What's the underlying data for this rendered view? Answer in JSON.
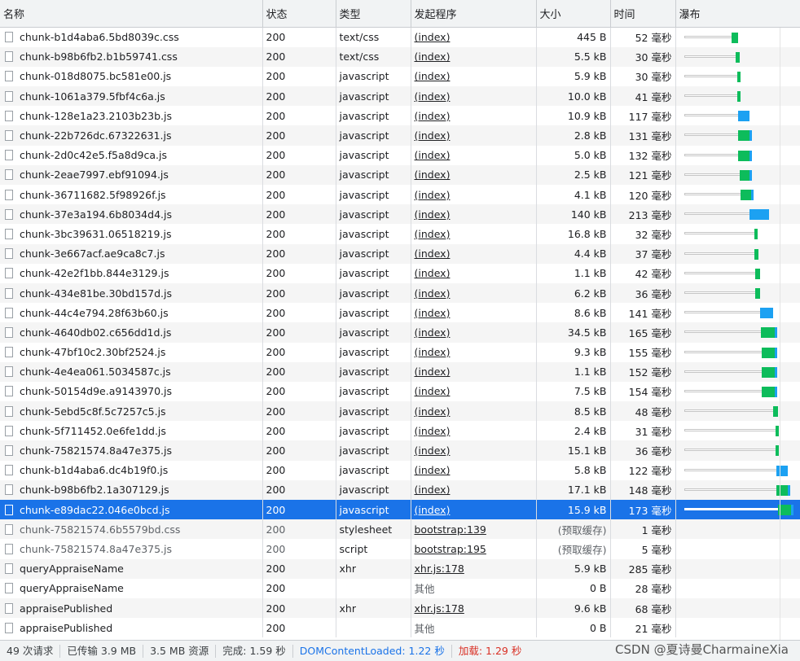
{
  "columns": [
    "名称",
    "状态",
    "类型",
    "发起程序",
    "大小",
    "时间",
    "瀑布"
  ],
  "rows": [
    {
      "name": "chunk-b1d4aba6.5bd8039c.css",
      "status": "200",
      "type": "text/css",
      "initiator": "(index)",
      "size": "445 B",
      "time": "52 毫秒"
    },
    {
      "name": "chunk-b98b6fb2.b1b59741.css",
      "status": "200",
      "type": "text/css",
      "initiator": "(index)",
      "size": "5.5 kB",
      "time": "30 毫秒"
    },
    {
      "name": "chunk-018d8075.bc581e00.js",
      "status": "200",
      "type": "javascript",
      "initiator": "(index)",
      "size": "5.9 kB",
      "time": "30 毫秒"
    },
    {
      "name": "chunk-1061a379.5fbf4c6a.js",
      "status": "200",
      "type": "javascript",
      "initiator": "(index)",
      "size": "10.0 kB",
      "time": "41 毫秒"
    },
    {
      "name": "chunk-128e1a23.2103b23b.js",
      "status": "200",
      "type": "javascript",
      "initiator": "(index)",
      "size": "10.9 kB",
      "time": "117 毫秒"
    },
    {
      "name": "chunk-22b726dc.67322631.js",
      "status": "200",
      "type": "javascript",
      "initiator": "(index)",
      "size": "2.8 kB",
      "time": "131 毫秒"
    },
    {
      "name": "chunk-2d0c42e5.f5a8d9ca.js",
      "status": "200",
      "type": "javascript",
      "initiator": "(index)",
      "size": "5.0 kB",
      "time": "132 毫秒"
    },
    {
      "name": "chunk-2eae7997.ebf91094.js",
      "status": "200",
      "type": "javascript",
      "initiator": "(index)",
      "size": "2.5 kB",
      "time": "121 毫秒"
    },
    {
      "name": "chunk-36711682.5f98926f.js",
      "status": "200",
      "type": "javascript",
      "initiator": "(index)",
      "size": "4.1 kB",
      "time": "120 毫秒"
    },
    {
      "name": "chunk-37e3a194.6b8034d4.js",
      "status": "200",
      "type": "javascript",
      "initiator": "(index)",
      "size": "140 kB",
      "time": "213 毫秒"
    },
    {
      "name": "chunk-3bc39631.06518219.js",
      "status": "200",
      "type": "javascript",
      "initiator": "(index)",
      "size": "16.8 kB",
      "time": "32 毫秒"
    },
    {
      "name": "chunk-3e667acf.ae9ca8c7.js",
      "status": "200",
      "type": "javascript",
      "initiator": "(index)",
      "size": "4.4 kB",
      "time": "37 毫秒"
    },
    {
      "name": "chunk-42e2f1bb.844e3129.js",
      "status": "200",
      "type": "javascript",
      "initiator": "(index)",
      "size": "1.1 kB",
      "time": "42 毫秒"
    },
    {
      "name": "chunk-434e81be.30bd157d.js",
      "status": "200",
      "type": "javascript",
      "initiator": "(index)",
      "size": "6.2 kB",
      "time": "36 毫秒"
    },
    {
      "name": "chunk-44c4e794.28f63b60.js",
      "status": "200",
      "type": "javascript",
      "initiator": "(index)",
      "size": "8.6 kB",
      "time": "141 毫秒"
    },
    {
      "name": "chunk-4640db02.c656dd1d.js",
      "status": "200",
      "type": "javascript",
      "initiator": "(index)",
      "size": "34.5 kB",
      "time": "165 毫秒"
    },
    {
      "name": "chunk-47bf10c2.30bf2524.js",
      "status": "200",
      "type": "javascript",
      "initiator": "(index)",
      "size": "9.3 kB",
      "time": "155 毫秒"
    },
    {
      "name": "chunk-4e4ea061.5034587c.js",
      "status": "200",
      "type": "javascript",
      "initiator": "(index)",
      "size": "1.1 kB",
      "time": "152 毫秒"
    },
    {
      "name": "chunk-50154d9e.a9143970.js",
      "status": "200",
      "type": "javascript",
      "initiator": "(index)",
      "size": "7.5 kB",
      "time": "154 毫秒"
    },
    {
      "name": "chunk-5ebd5c8f.5c7257c5.js",
      "status": "200",
      "type": "javascript",
      "initiator": "(index)",
      "size": "8.5 kB",
      "time": "48 毫秒"
    },
    {
      "name": "chunk-5f711452.0e6fe1dd.js",
      "status": "200",
      "type": "javascript",
      "initiator": "(index)",
      "size": "2.4 kB",
      "time": "31 毫秒"
    },
    {
      "name": "chunk-75821574.8a47e375.js",
      "status": "200",
      "type": "javascript",
      "initiator": "(index)",
      "size": "15.1 kB",
      "time": "36 毫秒"
    },
    {
      "name": "chunk-b1d4aba6.dc4b19f0.js",
      "status": "200",
      "type": "javascript",
      "initiator": "(index)",
      "size": "5.8 kB",
      "time": "122 毫秒"
    },
    {
      "name": "chunk-b98b6fb2.1a307129.js",
      "status": "200",
      "type": "javascript",
      "initiator": "(index)",
      "size": "17.1 kB",
      "time": "148 毫秒"
    },
    {
      "name": "chunk-e89dac22.046e0bcd.js",
      "status": "200",
      "type": "javascript",
      "initiator": "(index)",
      "size": "15.9 kB",
      "time": "173 毫秒"
    },
    {
      "name": "chunk-75821574.6b5579bd.css",
      "status": "200",
      "type": "stylesheet",
      "initiator": "bootstrap:139",
      "size": "(预取缓存)",
      "time": "1 毫秒"
    },
    {
      "name": "chunk-75821574.8a47e375.js",
      "status": "200",
      "type": "script",
      "initiator": "bootstrap:195",
      "size": "(预取缓存)",
      "time": "5 毫秒"
    },
    {
      "name": "queryAppraiseName",
      "status": "200",
      "type": "xhr",
      "initiator": "xhr.js:178",
      "size": "5.9 kB",
      "time": "285 毫秒"
    },
    {
      "name": "queryAppraiseName",
      "status": "200",
      "type": "",
      "initiator": "其他",
      "size": "0 B",
      "time": "28 毫秒"
    },
    {
      "name": "appraisePublished",
      "status": "200",
      "type": "xhr",
      "initiator": "xhr.js:178",
      "size": "9.6 kB",
      "time": "68 毫秒"
    },
    {
      "name": "appraisePublished",
      "status": "200",
      "type": "",
      "initiator": "其他",
      "size": "0 B",
      "time": "21 毫秒"
    }
  ],
  "waterfall": [
    {
      "start": 0.0,
      "wait_end": 0.42,
      "end": 0.48,
      "blue": false
    },
    {
      "start": 0.0,
      "wait_end": 0.46,
      "end": 0.49,
      "blue": false
    },
    {
      "start": 0.0,
      "wait_end": 0.47,
      "end": 0.5,
      "blue": false
    },
    {
      "start": 0.0,
      "wait_end": 0.47,
      "end": 0.5,
      "blue": false
    },
    {
      "start": 0.0,
      "wait_end": 0.48,
      "end": 0.58,
      "blue": true
    },
    {
      "start": 0.0,
      "wait_end": 0.48,
      "end": 0.59,
      "blue": false
    },
    {
      "start": 0.0,
      "wait_end": 0.48,
      "end": 0.59,
      "blue": false
    },
    {
      "start": 0.0,
      "wait_end": 0.49,
      "end": 0.59,
      "blue": false
    },
    {
      "start": 0.0,
      "wait_end": 0.5,
      "end": 0.61,
      "blue": false
    },
    {
      "start": 0.0,
      "wait_end": 0.58,
      "end": 0.75,
      "blue": true
    },
    {
      "start": 0.0,
      "wait_end": 0.62,
      "end": 0.65,
      "blue": false
    },
    {
      "start": 0.0,
      "wait_end": 0.62,
      "end": 0.66,
      "blue": false
    },
    {
      "start": 0.0,
      "wait_end": 0.63,
      "end": 0.67,
      "blue": false
    },
    {
      "start": 0.0,
      "wait_end": 0.63,
      "end": 0.67,
      "blue": false
    },
    {
      "start": 0.0,
      "wait_end": 0.67,
      "end": 0.79,
      "blue": true
    },
    {
      "start": 0.0,
      "wait_end": 0.68,
      "end": 0.82,
      "blue": false
    },
    {
      "start": 0.0,
      "wait_end": 0.69,
      "end": 0.82,
      "blue": false
    },
    {
      "start": 0.0,
      "wait_end": 0.69,
      "end": 0.82,
      "blue": false
    },
    {
      "start": 0.0,
      "wait_end": 0.69,
      "end": 0.82,
      "blue": false
    },
    {
      "start": 0.0,
      "wait_end": 0.79,
      "end": 0.83,
      "blue": false
    },
    {
      "start": 0.0,
      "wait_end": 0.81,
      "end": 0.84,
      "blue": false
    },
    {
      "start": 0.0,
      "wait_end": 0.81,
      "end": 0.84,
      "blue": false
    },
    {
      "start": 0.0,
      "wait_end": 0.82,
      "end": 0.92,
      "blue": true
    },
    {
      "start": 0.0,
      "wait_end": 0.82,
      "end": 0.93,
      "blue": false
    },
    {
      "start": 0.0,
      "wait_end": 0.83,
      "end": 0.96,
      "blue": false
    },
    null,
    null,
    null,
    null,
    null,
    null
  ],
  "selected_row": 24,
  "dim_rows": [
    25,
    26
  ],
  "statusbar": {
    "requests": "49 次请求",
    "transferred": "已传输 3.9 MB",
    "resources": "3.5 MB 资源",
    "finish": "完成: 1.59 秒",
    "dcl": "DOMContentLoaded: 1.22 秒",
    "load": "加载: 1.29 秒"
  },
  "watermark": "CSDN @夏诗曼CharmaineXia",
  "colors": {
    "selected": "#1a73e8",
    "waterfall_green": "#0dbc5b",
    "waterfall_blue": "#1ca1f2",
    "dcl": "#1a73e8",
    "load": "#d93025"
  }
}
